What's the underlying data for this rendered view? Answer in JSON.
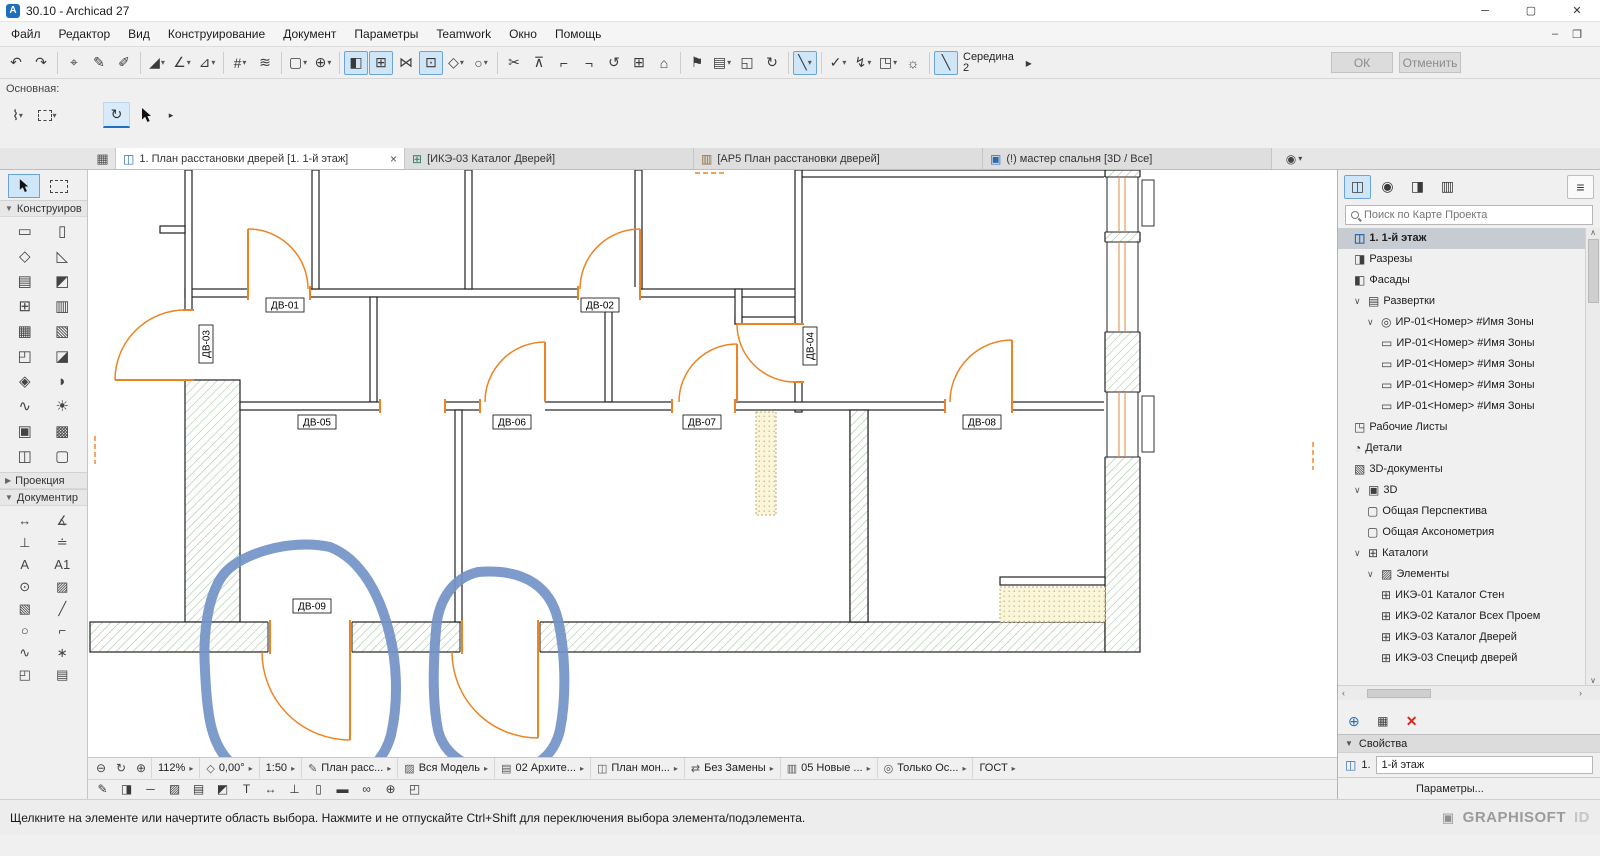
{
  "window": {
    "title": "30.10 - Archicad 27"
  },
  "menu": {
    "items": [
      "Файл",
      "Редактор",
      "Вид",
      "Конструирование",
      "Документ",
      "Параметры",
      "Teamwork",
      "Окно",
      "Помощь"
    ]
  },
  "toolbar": {
    "anchor_label": "Середина",
    "anchor_value": "2",
    "ok": "ОК",
    "cancel": "Отменить"
  },
  "basic": {
    "label": "Основная:"
  },
  "tabs": {
    "items": [
      {
        "label": "1. План расстановки дверей [1. 1-й этаж]"
      },
      {
        "label": "[ИКЭ-03 Каталог Дверей]"
      },
      {
        "label": "[АР5 План расстановки дверей]"
      },
      {
        "label": "(!) мастер спальня [3D / Все]"
      }
    ]
  },
  "toolbox": {
    "sections": [
      "Конструиров",
      "Проекция",
      "Документир"
    ]
  },
  "plan": {
    "door_labels": [
      "ДВ-01",
      "ДВ-02",
      "ДВ-03",
      "ДВ-04",
      "ДВ-05",
      "ДВ-06",
      "ДВ-07",
      "ДВ-08",
      "ДВ-09"
    ]
  },
  "navigator": {
    "search_placeholder": "Поиск по Карте Проекта",
    "items": [
      {
        "label": "1. 1-й этаж"
      },
      {
        "label": "Разрезы"
      },
      {
        "label": "Фасады"
      },
      {
        "label": "Развертки"
      },
      {
        "label": "ИР-01<Номер> #Имя Зоны"
      },
      {
        "label": "ИР-01<Номер> #Имя Зоны"
      },
      {
        "label": "ИР-01<Номер> #Имя Зоны"
      },
      {
        "label": "ИР-01<Номер> #Имя Зоны"
      },
      {
        "label": "ИР-01<Номер> #Имя Зоны"
      },
      {
        "label": "Рабочие Листы"
      },
      {
        "label": "Детали"
      },
      {
        "label": "3D-документы"
      },
      {
        "label": "3D"
      },
      {
        "label": "Общая Перспектива"
      },
      {
        "label": "Общая Аксонометрия"
      },
      {
        "label": "Каталоги"
      },
      {
        "label": "Элементы"
      },
      {
        "label": "ИКЭ-01 Каталог Стен"
      },
      {
        "label": "ИКЭ-02 Каталог Всех Проем"
      },
      {
        "label": "ИКЭ-03 Каталог Дверей"
      },
      {
        "label": "ИКЭ-03 Специф дверей"
      }
    ],
    "properties_label": "Свойства",
    "floor_prefix": "1.",
    "floor_value": "1-й этаж",
    "parameters_label": "Параметры..."
  },
  "zoombar": {
    "zoom": "112%",
    "rotation": "0,00°",
    "scale": "1:50",
    "pens": "План расс...",
    "model": "Вся Модель",
    "layers": "02 Архите...",
    "plan_type": "План мон...",
    "overrides": "Без Замены",
    "revision": "05 Новые ...",
    "filter": "Только Ос...",
    "standard": "ГОСТ"
  },
  "status": {
    "message": "Щелкните на элементе или начертите область выбора. Нажмите и не отпускайте Ctrl+Shift для переключения выбора элемента/подэлемента.",
    "brand": "GRAPHISOFT",
    "brand_suffix": "ID"
  }
}
